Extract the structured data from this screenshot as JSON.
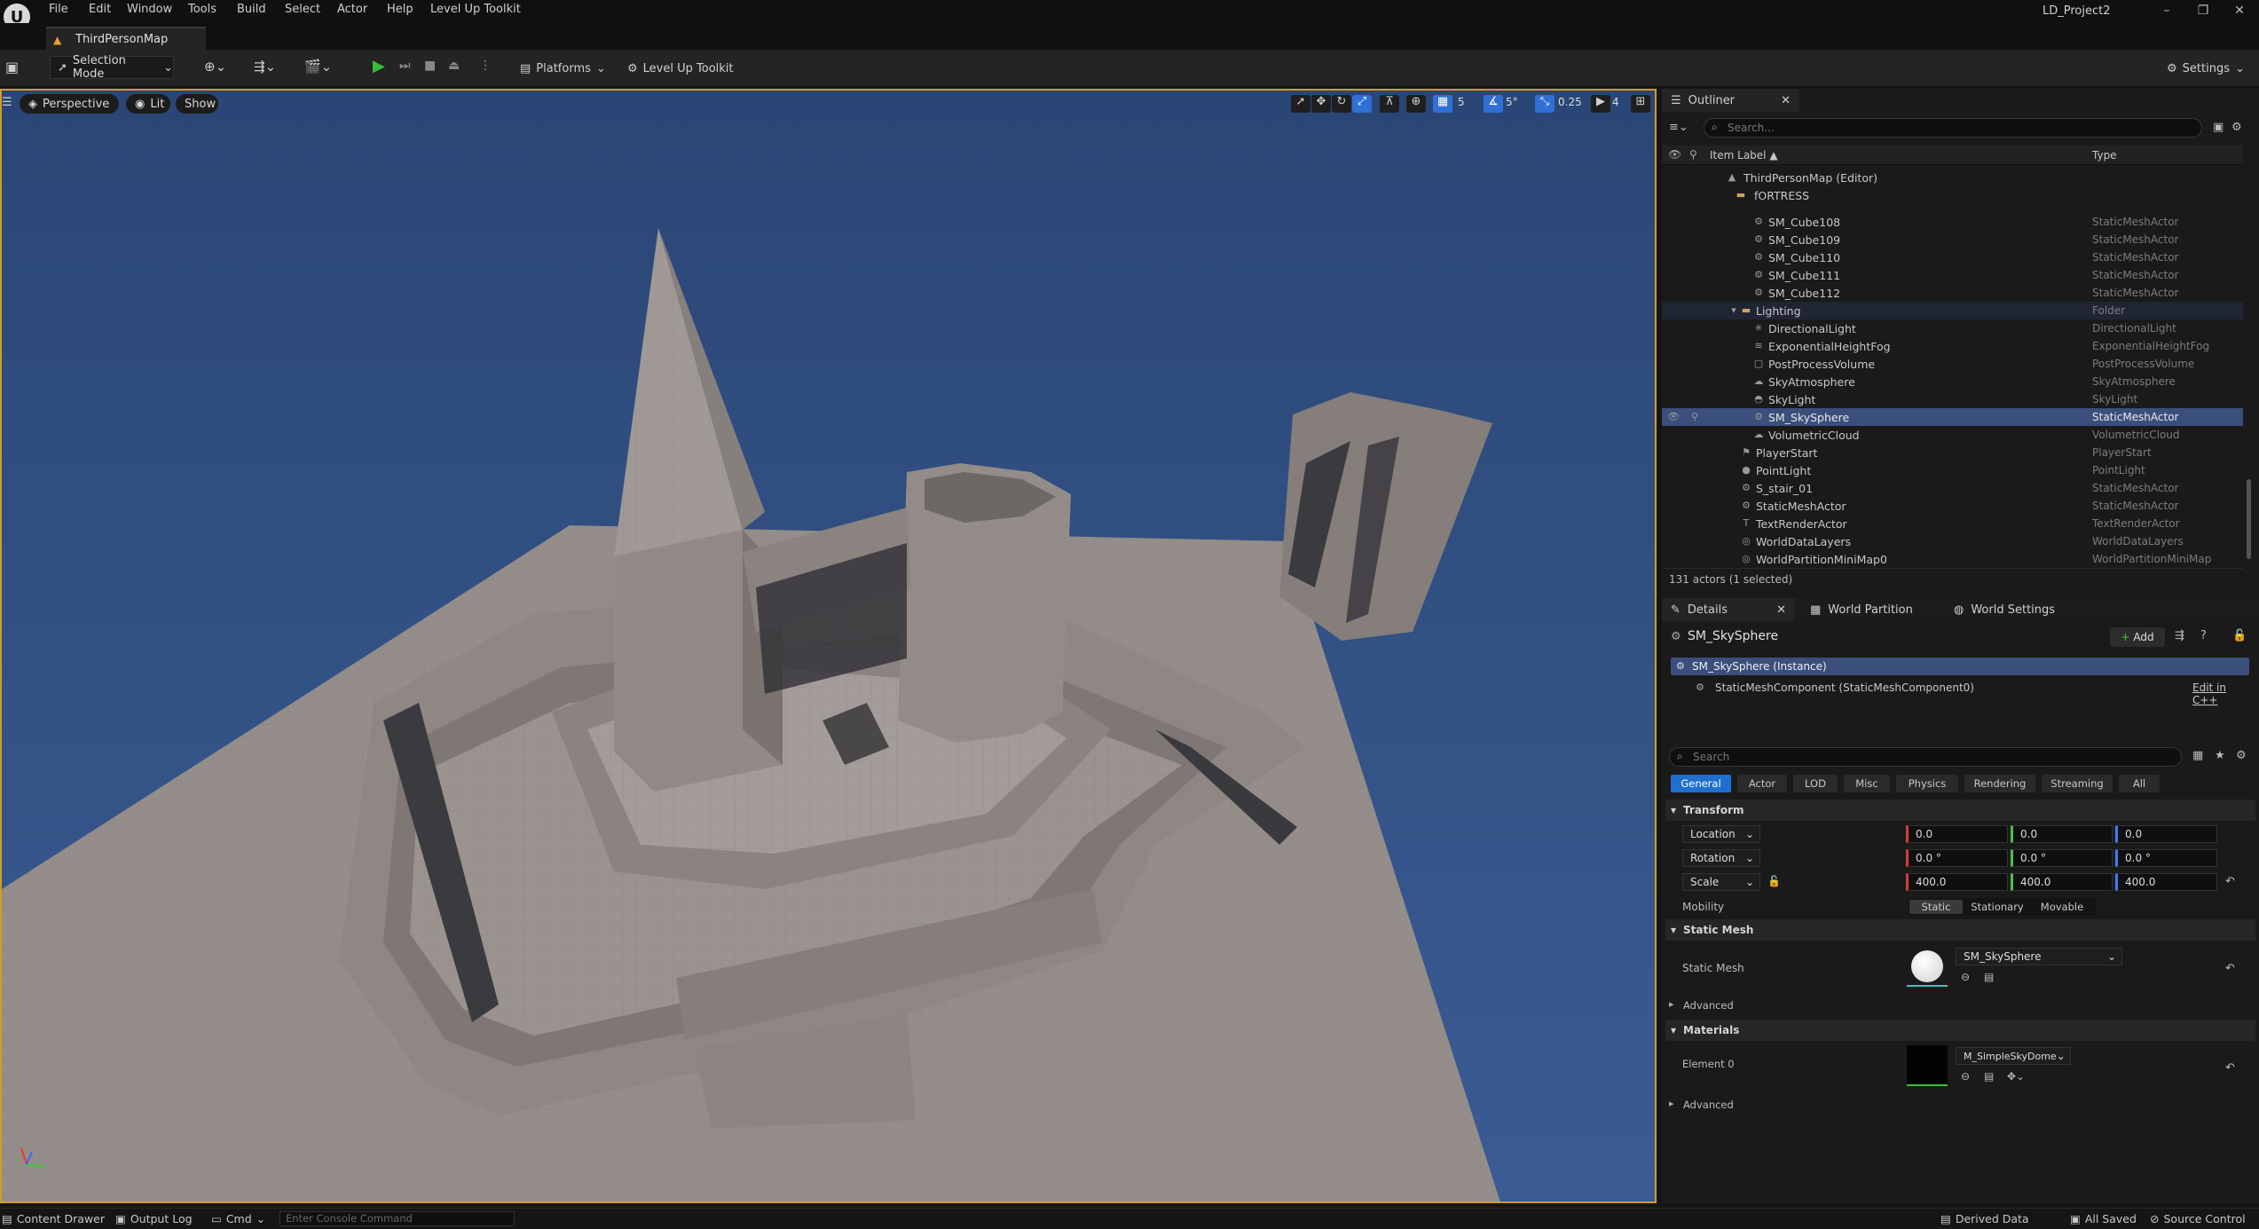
{
  "app": {
    "menu": [
      "File",
      "Edit",
      "Window",
      "Tools",
      "Build",
      "Select",
      "Actor",
      "Help",
      "Level Up Toolkit"
    ],
    "project_name": "LD_Project2",
    "map_tab": "ThirdPersonMap"
  },
  "toolbar": {
    "selection_mode": "Selection Mode",
    "platforms": "Platforms",
    "level_up_toolkit": "Level Up Toolkit",
    "settings": "Settings"
  },
  "viewport": {
    "perspective": "Perspective",
    "lit": "Lit",
    "show": "Show",
    "grid_snap": "5",
    "rotation_snap": "5°",
    "scale_snap": "0.25",
    "camera_speed": "4"
  },
  "outliner": {
    "tab": "Outliner",
    "search_placeholder": "Search...",
    "col_label": "Item Label ▲",
    "col_type": "Type",
    "root": "ThirdPersonMap (Editor)",
    "folder_fortress": "fORTRESS",
    "rows": [
      {
        "label": "SM_Cube108",
        "type": "StaticMeshActor"
      },
      {
        "label": "SM_Cube109",
        "type": "StaticMeshActor"
      },
      {
        "label": "SM_Cube110",
        "type": "StaticMeshActor"
      },
      {
        "label": "SM_Cube111",
        "type": "StaticMeshActor"
      },
      {
        "label": "SM_Cube112",
        "type": "StaticMeshActor"
      },
      {
        "label": "Lighting",
        "type": "Folder"
      },
      {
        "label": "DirectionalLight",
        "type": "DirectionalLight"
      },
      {
        "label": "ExponentialHeightFog",
        "type": "ExponentialHeightFog"
      },
      {
        "label": "PostProcessVolume",
        "type": "PostProcessVolume"
      },
      {
        "label": "SkyAtmosphere",
        "type": "SkyAtmosphere"
      },
      {
        "label": "SkyLight",
        "type": "SkyLight"
      },
      {
        "label": "SM_SkySphere",
        "type": "StaticMeshActor"
      },
      {
        "label": "VolumetricCloud",
        "type": "VolumetricCloud"
      },
      {
        "label": "PlayerStart",
        "type": "PlayerStart"
      },
      {
        "label": "PointLight",
        "type": "PointLight"
      },
      {
        "label": "S_stair_01",
        "type": "StaticMeshActor"
      },
      {
        "label": "StaticMeshActor",
        "type": "StaticMeshActor"
      },
      {
        "label": "TextRenderActor",
        "type": "TextRenderActor"
      },
      {
        "label": "WorldDataLayers",
        "type": "WorldDataLayers"
      },
      {
        "label": "WorldPartitionMiniMap0",
        "type": "WorldPartitionMiniMap"
      }
    ],
    "status": "131 actors (1 selected)"
  },
  "details": {
    "tabs": [
      "Details",
      "World Partition",
      "World Settings"
    ],
    "actor_name": "SM_SkySphere",
    "add_label": "Add",
    "instance": "SM_SkySphere (Instance)",
    "component": "StaticMeshComponent (StaticMeshComponent0)",
    "edit_cpp": "Edit in C++",
    "search_placeholder": "Search",
    "filters": [
      "General",
      "Actor",
      "LOD",
      "Misc",
      "Physics",
      "Rendering",
      "Streaming",
      "All"
    ],
    "transform_header": "Transform",
    "location_label": "Location",
    "rotation_label": "Rotation",
    "scale_label": "Scale",
    "location": [
      "0.0",
      "0.0",
      "0.0"
    ],
    "rotation": [
      "0.0 °",
      "0.0 °",
      "0.0 °"
    ],
    "scale": [
      "400.0",
      "400.0",
      "400.0"
    ],
    "mobility_label": "Mobility",
    "mobility_options": [
      "Static",
      "Stationary",
      "Movable"
    ],
    "static_mesh_header": "Static Mesh",
    "static_mesh_label": "Static Mesh",
    "static_mesh_value": "SM_SkySphere",
    "advanced": "Advanced",
    "materials_header": "Materials",
    "element0_label": "Element 0",
    "element0_value": "M_SimpleSkyDome"
  },
  "statusbar": {
    "content_drawer": "Content Drawer",
    "output_log": "Output Log",
    "cmd": "Cmd",
    "console_placeholder": "Enter Console Command",
    "derived_data": "Derived Data",
    "all_saved": "All Saved",
    "source_control": "Source Control"
  },
  "colors": {
    "accent_blue": "#1f6fd0",
    "viewport_border": "#d49a2a",
    "sky": "#2d4a78",
    "mesh_gray": "#8e8784"
  }
}
